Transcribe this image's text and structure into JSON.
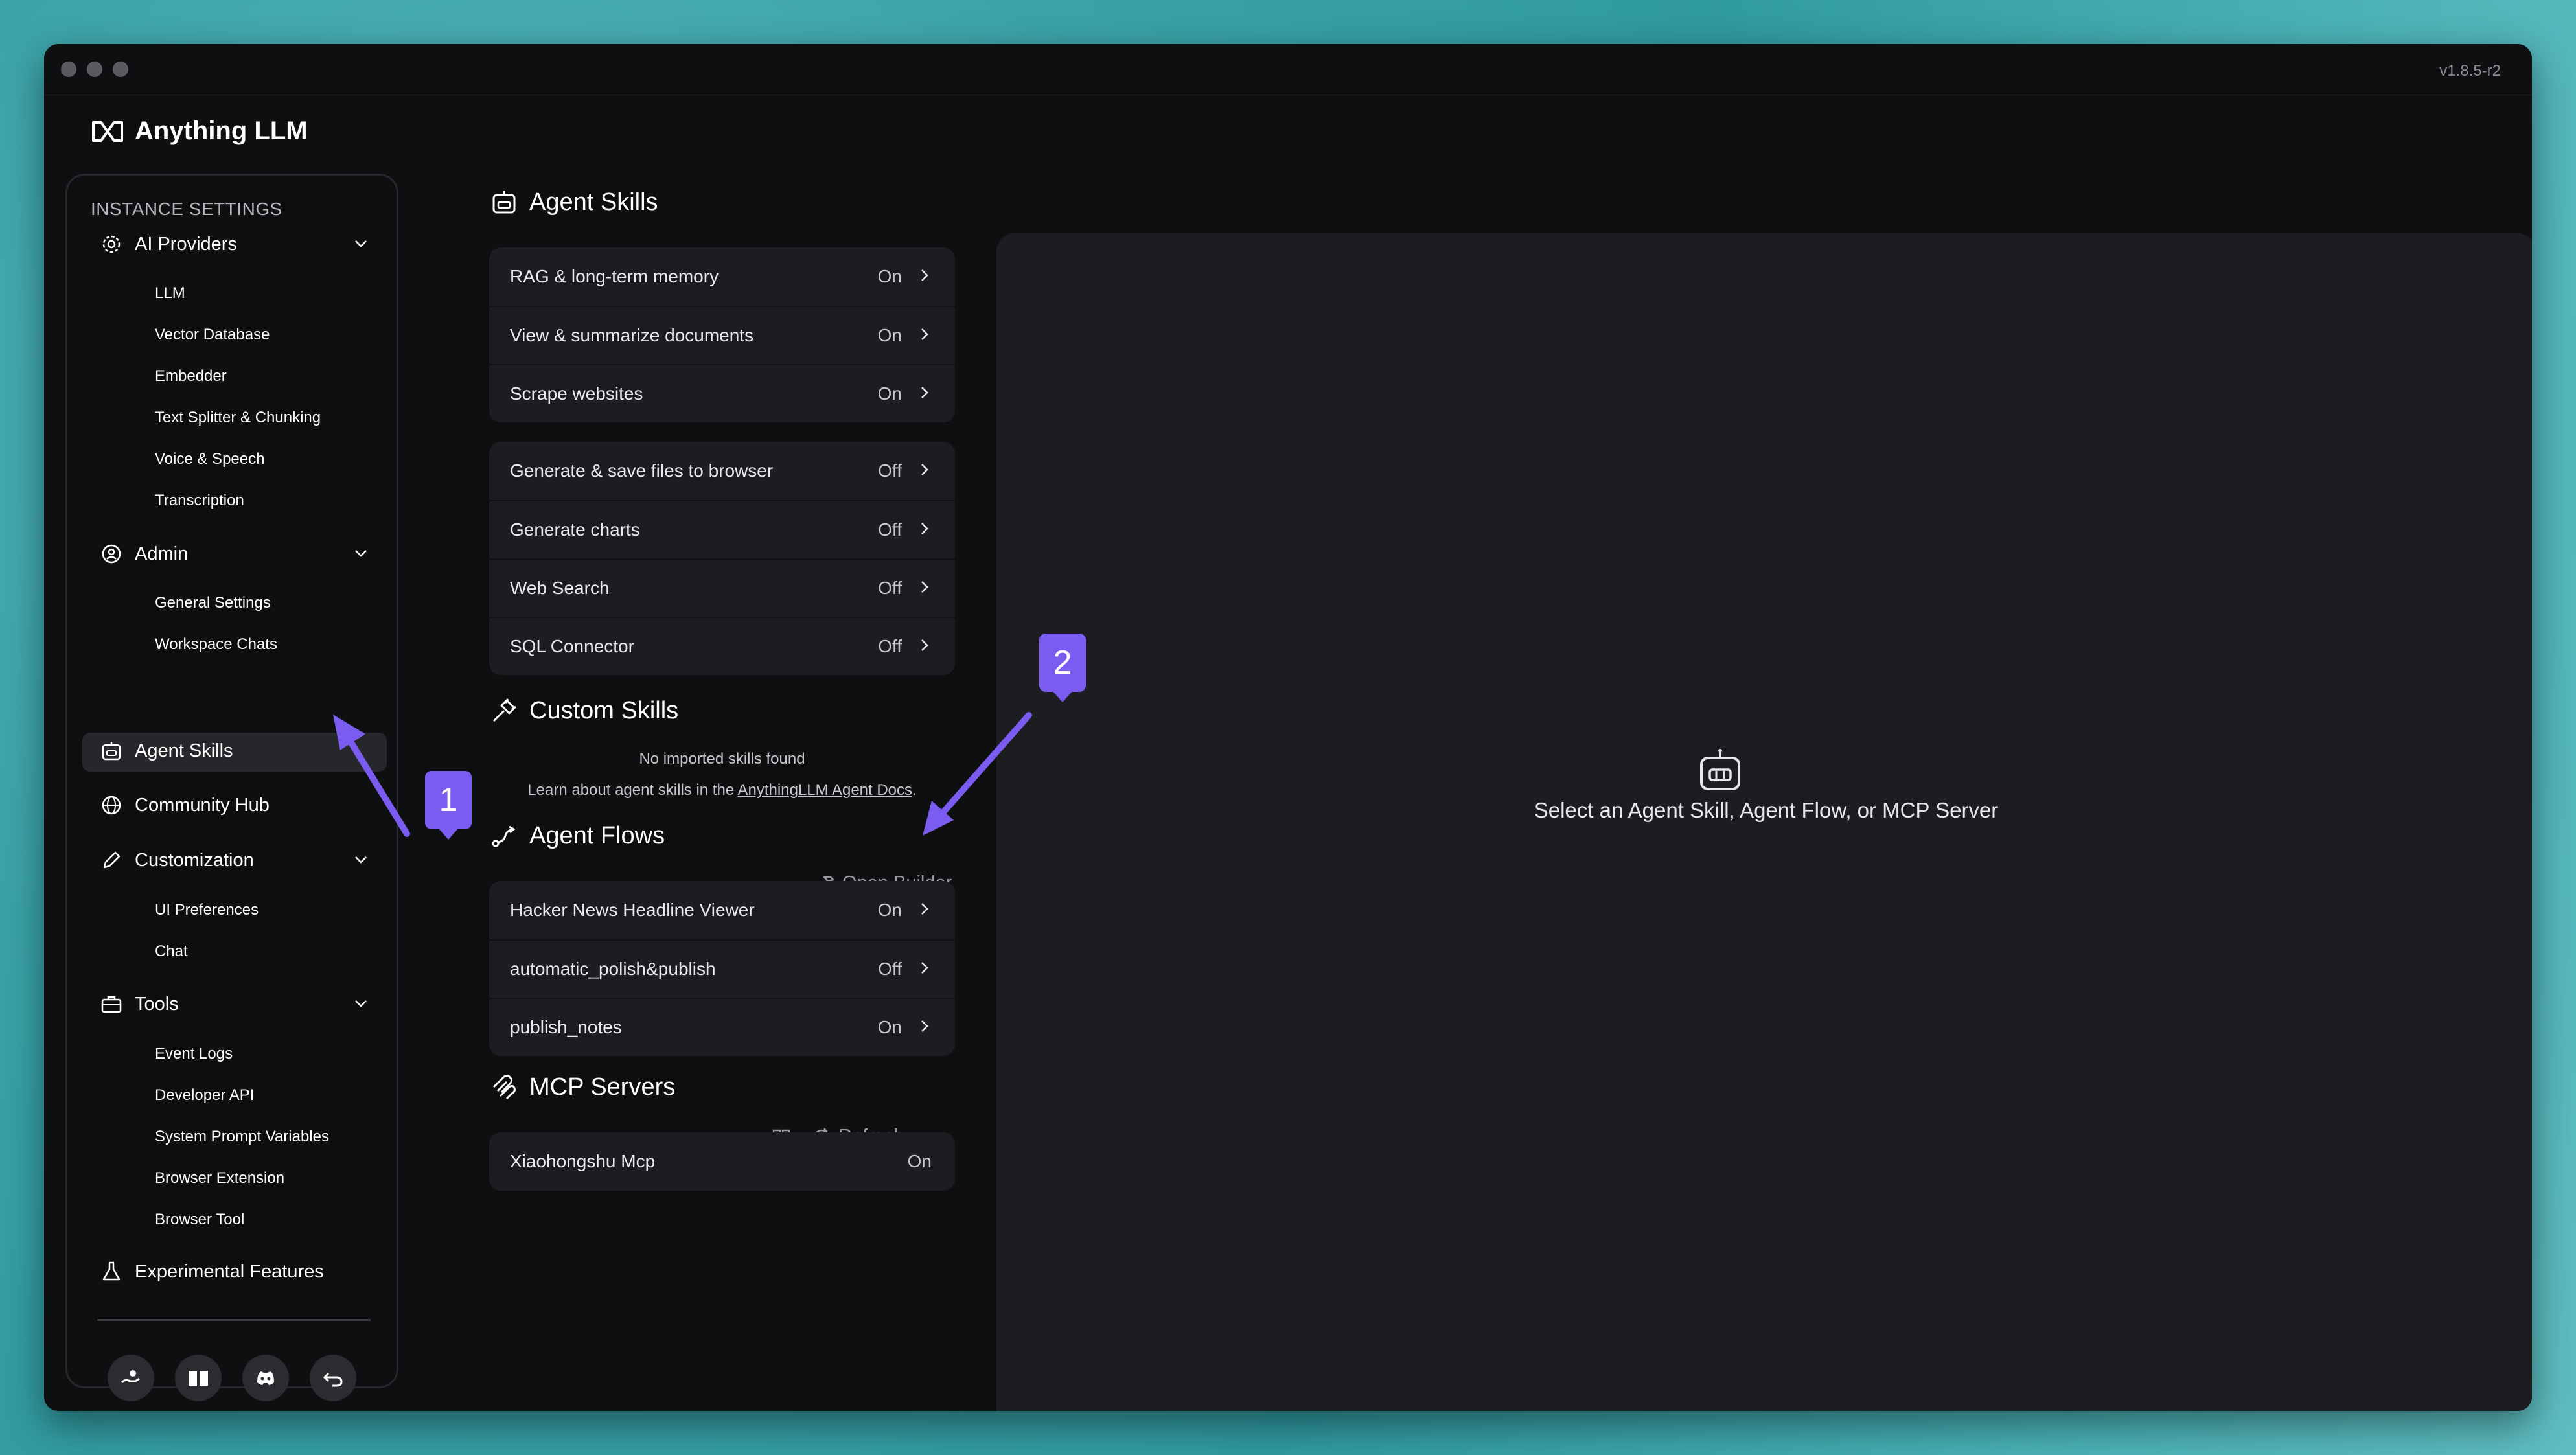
{
  "window": {
    "version": "v1.8.5-r2"
  },
  "brand": {
    "name": "Anything LLM"
  },
  "sidebar": {
    "header": "INSTANCE SETTINGS",
    "sections": {
      "ai_providers": {
        "label": "AI Providers",
        "items": [
          "LLM",
          "Vector Database",
          "Embedder",
          "Text Splitter & Chunking",
          "Voice & Speech",
          "Transcription"
        ]
      },
      "admin": {
        "label": "Admin",
        "items": [
          "General Settings",
          "Workspace Chats"
        ]
      },
      "agent_skills": {
        "label": "Agent Skills"
      },
      "community_hub": {
        "label": "Community Hub"
      },
      "customization": {
        "label": "Customization",
        "items": [
          "UI Preferences",
          "Chat"
        ]
      },
      "tools": {
        "label": "Tools",
        "items": [
          "Event Logs",
          "Developer API",
          "System Prompt Variables",
          "Browser Extension",
          "Browser Tool"
        ]
      },
      "experimental": {
        "label": "Experimental Features"
      }
    }
  },
  "agent_skills": {
    "title": "Agent Skills",
    "default_group": [
      {
        "label": "RAG & long-term memory",
        "status": "On"
      },
      {
        "label": "View & summarize documents",
        "status": "On"
      },
      {
        "label": "Scrape websites",
        "status": "On"
      }
    ],
    "optional_group": [
      {
        "label": "Generate & save files to browser",
        "status": "Off"
      },
      {
        "label": "Generate charts",
        "status": "Off"
      },
      {
        "label": "Web Search",
        "status": "Off"
      },
      {
        "label": "SQL Connector",
        "status": "Off"
      }
    ]
  },
  "custom_skills": {
    "title": "Custom Skills",
    "empty": "No imported skills found",
    "learn_prefix": "Learn about agent skills in the ",
    "learn_link": "AnythingLLM Agent Docs",
    "learn_suffix": "."
  },
  "agent_flows": {
    "title": "Agent Flows",
    "open_builder": "Open Builder",
    "items": [
      {
        "label": "Hacker News Headline Viewer",
        "status": "On"
      },
      {
        "label": "automatic_polish&publish",
        "status": "Off"
      },
      {
        "label": "publish_notes",
        "status": "On"
      }
    ]
  },
  "mcp_servers": {
    "title": "MCP Servers",
    "refresh": "Refresh",
    "items": [
      {
        "label": "Xiaohongshu Mcp",
        "status": "On"
      }
    ]
  },
  "detail_panel": {
    "empty_text": "Select an Agent Skill, Agent Flow, or MCP Server"
  },
  "callouts": {
    "one": "1",
    "two": "2"
  },
  "colors": {
    "accent": "#7b5cf0",
    "panel": "#1c1d20",
    "window": "#0e0f11"
  }
}
